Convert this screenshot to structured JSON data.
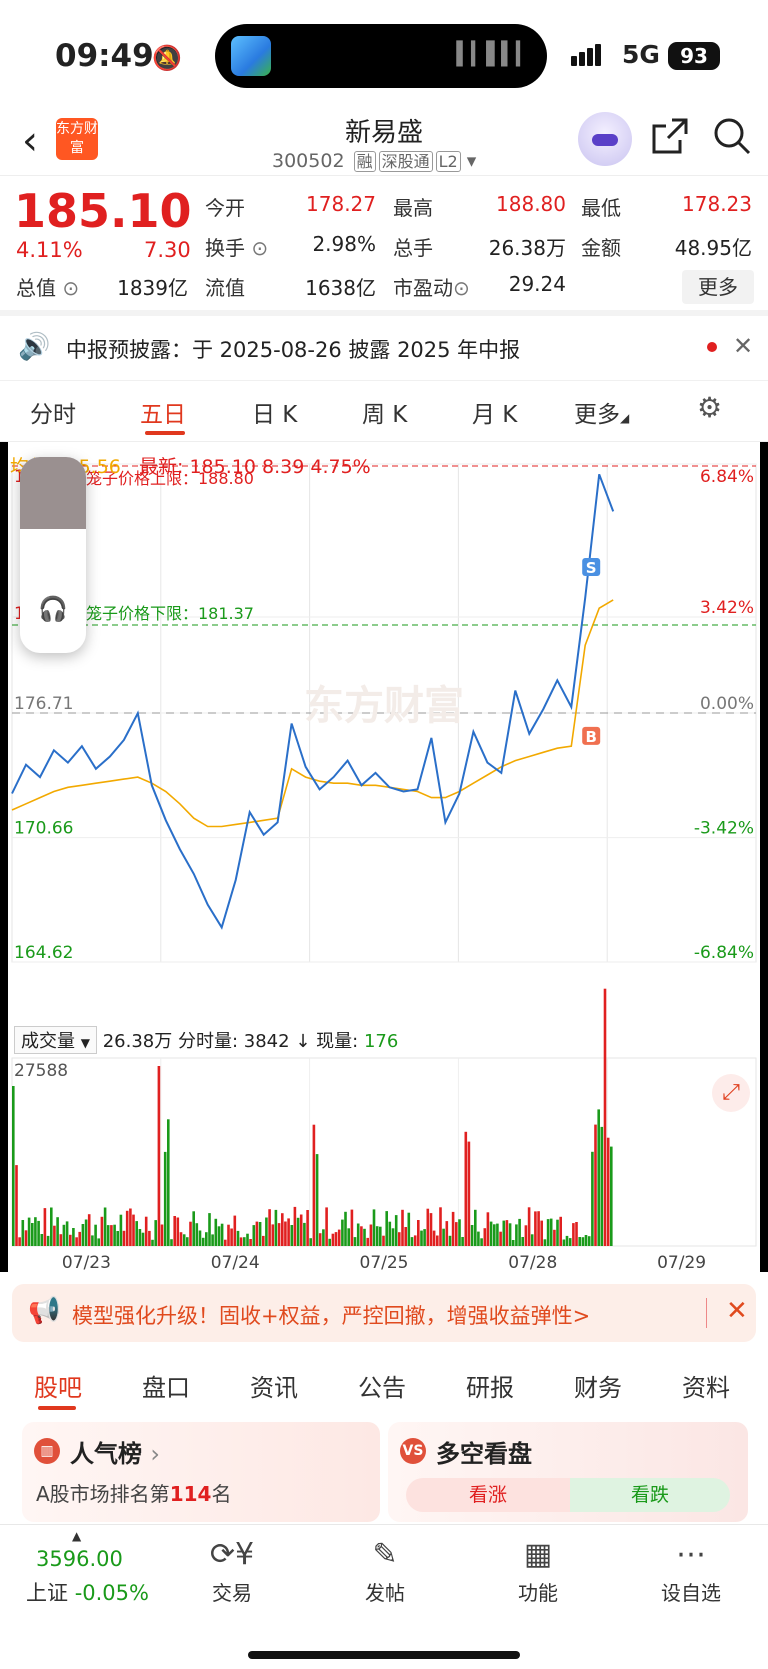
{
  "status_bar": {
    "time": "09:49",
    "network": "5G",
    "battery": "93"
  },
  "header": {
    "logo_text": "东方财富",
    "stock_name": "新易盛",
    "stock_code": "300502",
    "tags": [
      "融",
      "深股通",
      "L2"
    ]
  },
  "quote": {
    "price": "185.10",
    "change_pct": "4.11%",
    "change": "7.30",
    "fields": [
      {
        "label": "今开",
        "value": "178.27",
        "color": "red"
      },
      {
        "label": "最高",
        "value": "188.80",
        "color": "red"
      },
      {
        "label": "最低",
        "value": "178.23",
        "color": "red"
      },
      {
        "label": "换手",
        "value": "2.98%",
        "color": "black"
      },
      {
        "label": "总手",
        "value": "26.38万",
        "color": "black"
      },
      {
        "label": "金额",
        "value": "48.95亿",
        "color": "black"
      },
      {
        "label": "总值",
        "value": "1839亿",
        "color": "black"
      },
      {
        "label": "流值",
        "value": "1638亿",
        "color": "black"
      },
      {
        "label": "市盈动",
        "value": "29.24",
        "color": "black"
      }
    ],
    "more_label": "更多"
  },
  "notice": {
    "text": "中报预披露：于 2025-08-26 披露 2025 年中报"
  },
  "chart_tabs": [
    "分时",
    "五日",
    "日 K",
    "周 K",
    "月 K",
    "更多"
  ],
  "active_chart_tab": "五日",
  "chart_legend": {
    "avg_label": "均价:",
    "avg_value": "185.56",
    "latest_label": "最新:",
    "latest_value": "185.10",
    "latest_change": "8.39",
    "latest_pct": "4.75%"
  },
  "chart_data": {
    "type": "line",
    "title": "",
    "xlabel": "",
    "ylabel": "",
    "x": [
      "07/23",
      "07/24",
      "07/25",
      "07/28",
      "07/29"
    ],
    "ylim": [
      164.62,
      188.8
    ],
    "y_ticks_left": [
      "188.80",
      "181.37",
      "176.71",
      "170.66",
      "164.62"
    ],
    "y_ticks_right": [
      "6.84%",
      "3.42%",
      "0.00%",
      "-3.42%",
      "-6.84%"
    ],
    "reference_close": 176.71,
    "upper_limit_label": "笼子价格上限：188.80",
    "lower_limit_label": "笼子价格下限：181.37",
    "watermark": "东方财富",
    "series": [
      {
        "name": "最新",
        "color": "#2a6fc9",
        "values": [
          172.8,
          174.2,
          173.6,
          174.9,
          174.3,
          175.1,
          174.0,
          174.6,
          175.4,
          176.7,
          173.2,
          171.5,
          170.1,
          168.9,
          167.4,
          166.3,
          168.6,
          171.9,
          170.8,
          171.4,
          176.2,
          174.1,
          173.0,
          173.6,
          174.4,
          173.2,
          173.8,
          173.1,
          172.9,
          173.0,
          175.5,
          171.4,
          172.8,
          175.8,
          174.3,
          173.8,
          177.8,
          175.7,
          176.9,
          178.3,
          177.0,
          182.3,
          188.3,
          186.5
        ]
      },
      {
        "name": "均价",
        "color": "#f2a900",
        "values": [
          172.0,
          172.3,
          172.6,
          172.9,
          173.1,
          173.2,
          173.3,
          173.4,
          173.5,
          173.6,
          173.3,
          172.9,
          172.3,
          171.6,
          171.2,
          171.2,
          171.3,
          171.4,
          171.5,
          171.6,
          174.0,
          173.6,
          173.4,
          173.3,
          173.3,
          173.2,
          173.2,
          173.1,
          173.0,
          172.9,
          172.6,
          172.6,
          172.9,
          173.3,
          173.7,
          174.1,
          174.4,
          174.6,
          174.8,
          175.0,
          175.1,
          180.0,
          181.8,
          182.2
        ]
      }
    ],
    "markers": [
      {
        "label": "B",
        "value": 175.6
      },
      {
        "label": "S",
        "value": 183.8
      }
    ],
    "volume": {
      "summary_label": "成交量",
      "total": "26.38万",
      "per_minute_label": "分时量:",
      "per_minute": "3842",
      "current_label": "现量:",
      "current": "176",
      "max_label": "27588"
    }
  },
  "ad_banner": {
    "text": "模型强化升级！固收+权益，严控回撤，增强收益弹性>"
  },
  "bottom_tabs": [
    "股吧",
    "盘口",
    "资讯",
    "公告",
    "研报",
    "财务",
    "资料"
  ],
  "active_bottom_tab": "股吧",
  "cards": {
    "popularity": {
      "title": "人气榜",
      "rank_prefix": "A股市场排名第",
      "rank": "114",
      "rank_suffix": "名"
    },
    "bull_bear": {
      "title": "多空看盘",
      "up_label": "看涨",
      "down_label": "看跌"
    }
  },
  "bottom_nav": {
    "index_value": "3596.00",
    "index_name": "上证",
    "index_change": "-0.05%",
    "items": [
      "交易",
      "发帖",
      "功能",
      "设自选"
    ]
  }
}
